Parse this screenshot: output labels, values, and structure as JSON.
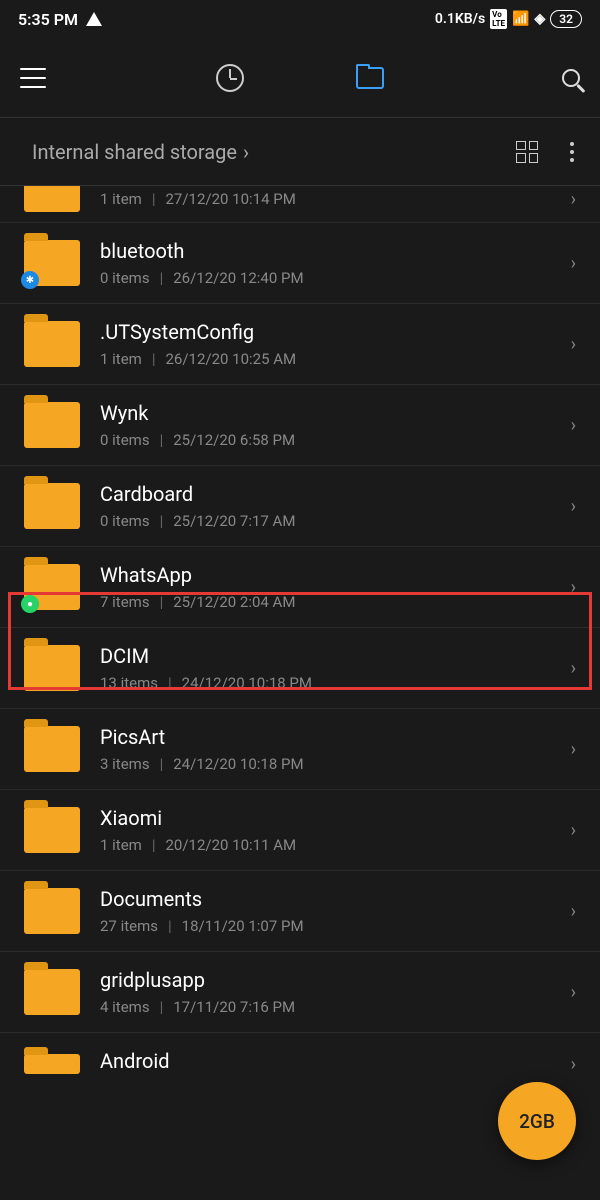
{
  "status": {
    "time": "5:35 PM",
    "speed": "0.1KB/s",
    "battery": "32"
  },
  "breadcrumb": {
    "path": "Internal shared storage"
  },
  "fab": {
    "label": "2GB"
  },
  "folders": [
    {
      "name": "",
      "items": "1 item",
      "date": "27/12/20 10:14 PM",
      "badge": null,
      "partial": "top"
    },
    {
      "name": "bluetooth",
      "items": "0 items",
      "date": "26/12/20 12:40 PM",
      "badge": "blue",
      "badge_char": "✱"
    },
    {
      "name": ".UTSystemConfig",
      "items": "1 item",
      "date": "26/12/20 10:25 AM",
      "badge": null
    },
    {
      "name": "Wynk",
      "items": "0 items",
      "date": "25/12/20 6:58 PM",
      "badge": null
    },
    {
      "name": "Cardboard",
      "items": "0 items",
      "date": "25/12/20 7:17 AM",
      "badge": null
    },
    {
      "name": "WhatsApp",
      "items": "7 items",
      "date": "25/12/20 2:04 AM",
      "badge": "green",
      "badge_char": "●",
      "highlighted": true
    },
    {
      "name": "DCIM",
      "items": "13 items",
      "date": "24/12/20 10:18 PM",
      "badge": null
    },
    {
      "name": "PicsArt",
      "items": "3 items",
      "date": "24/12/20 10:18 PM",
      "badge": null
    },
    {
      "name": "Xiaomi",
      "items": "1 item",
      "date": "20/12/20 10:11 AM",
      "badge": null
    },
    {
      "name": "Documents",
      "items": "27 items",
      "date": "18/11/20 1:07 PM",
      "badge": null
    },
    {
      "name": "gridplusapp",
      "items": "4 items",
      "date": "17/11/20 7:16 PM",
      "badge": null
    },
    {
      "name": "Android",
      "items": "",
      "date": "",
      "badge": null,
      "partial": "bottom"
    }
  ]
}
